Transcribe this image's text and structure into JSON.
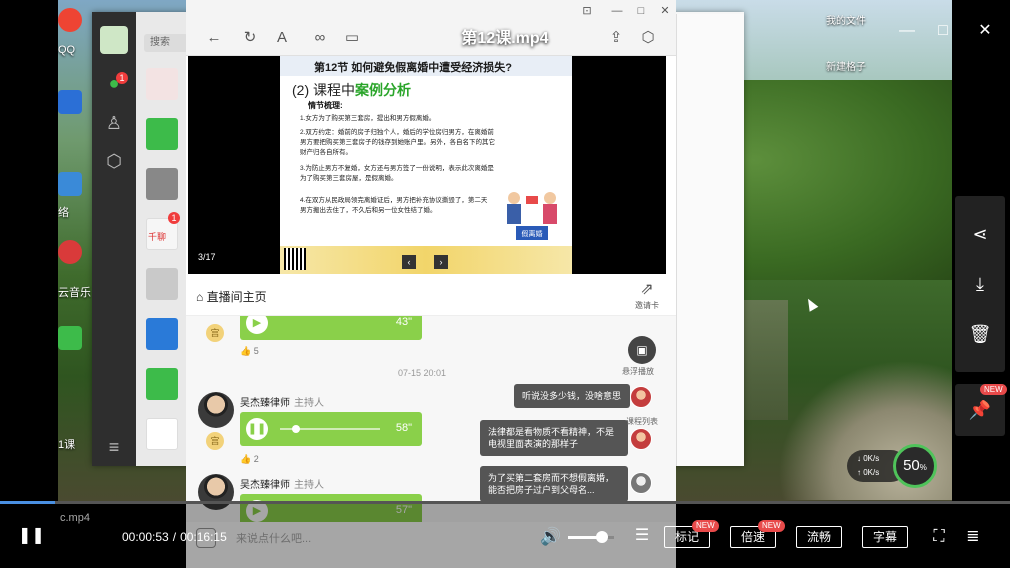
{
  "player": {
    "title": "第12课.mp4",
    "current_time": "00:00:53",
    "separator": "/",
    "total_time": "00:16:15",
    "progress_fraction": 0.054,
    "volume_fraction": 0.65,
    "buttons": {
      "mark": "标记",
      "speed": "倍速",
      "quality": "流畅",
      "subtitle": "字幕"
    },
    "new_badge": "NEW",
    "net_down": "0K/s",
    "net_up": "0K/s",
    "cpu_percent": "50",
    "cpu_unit": "%"
  },
  "desktop": {
    "my_files": "我的文件",
    "new_folder": "新建格子",
    "qq_label": "QQ",
    "left_labels": [
      "络",
      "云音乐",
      "1课",
      "c.mp4"
    ]
  },
  "qq": {
    "search_placeholder": "搜索",
    "chat_badge": "1",
    "contact_badge": "1",
    "contact_label": "千聊"
  },
  "slide": {
    "title": "第12节  如何避免假离婚中遭受经济损失?",
    "subtitle_prefix": "(2) 课程中",
    "subtitle_highlight": "案例分析",
    "heading": "情节梳理:",
    "lines": [
      "1.女方为了购买第三套房，提出和男方假离婚。",
      "2.双方约定：婚前的房子归独个人，婚后的学位房归男方，在离婚前男方要把购买第三套房子的钱存到她账户里。另外，各自名下的其它财产归各自所有。",
      "3.为防止男方不复婚，女方还与男方签了一份说明，表示此次离婚是为了购买第三套房屋，是假离婚。",
      "4.在双方从民政局领完离婚证后，男方把补充协议撕毁了，第二天男方搬出去住了，不久后和另一位女性结了婚。"
    ],
    "page": "3/17",
    "illus_label": "假离婚"
  },
  "live": {
    "home": "直播间主页",
    "share": "邀请卡",
    "float_label": "悬浮播放",
    "float_label2": "课程列表",
    "input_placeholder": "来说点什么吧...",
    "timestamp": "07-15 20:01",
    "messages": [
      {
        "name": "吴杰臻律师",
        "role": "主持人",
        "duration": "43\"",
        "likes": "5"
      },
      {
        "name": "吴杰臻律师",
        "role": "主持人",
        "duration": "58\"",
        "likes": "2"
      },
      {
        "name": "吴杰臻律师",
        "role": "主持人",
        "duration": "57\""
      }
    ],
    "bubbles": [
      "听说没多少钱，没啥意思",
      "法律都是看物质不看精神，不是电视里面表演的那样子",
      "为了买第二套房而不想假离婚，能否把房子过户到父母名..."
    ]
  },
  "colors": {
    "accent": "#8ad04a",
    "progress": "#4a90e2",
    "badge": "#e84a4a"
  }
}
